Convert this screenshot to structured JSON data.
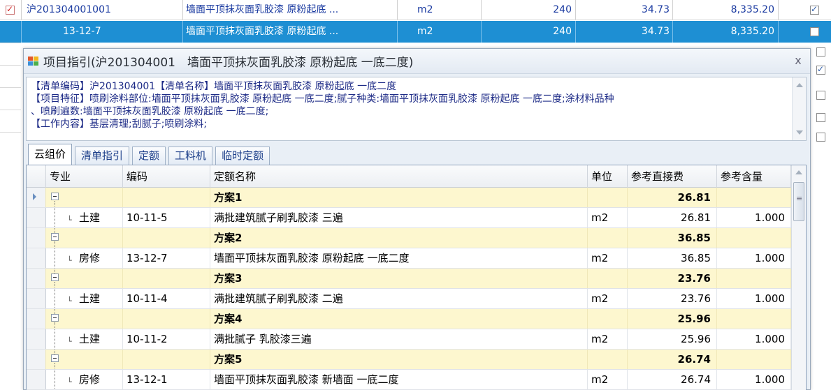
{
  "background_rows": [
    {
      "selected": false,
      "checked": true,
      "code": "沪201304001001",
      "name": "墙面平顶抹灰面乳胶漆 原粉起底 ...",
      "unit": "m2",
      "qty": "240",
      "price": "34.73",
      "total": "8,335.20",
      "right_checked": true
    },
    {
      "selected": true,
      "checked": false,
      "code": "13-12-7",
      "name": "墙面平顶抹灰面乳胶漆 原粉起底 ...",
      "unit": "m2",
      "qty": "240",
      "price": "34.73",
      "total": "8,335.20",
      "right_checked": false
    }
  ],
  "side_checkboxes": [
    false,
    true,
    false,
    false,
    false
  ],
  "dialog": {
    "title": "项目指引(沪201304001　墙面平顶抹灰面乳胶漆 原粉起底 一底二度)",
    "close_glyph": "x",
    "info_lines": [
      "【清单编码】沪201304001【清单名称】墙面平顶抹灰面乳胶漆 原粉起底 一底二度",
      "【项目特征】喷刷涂料部位:墙面平顶抹灰面乳胶漆 原粉起底 一底二度;腻子种类:墙面平顶抹灰面乳胶漆 原粉起底 一底二度;涂材料品种",
      "、喷刷遍数:墙面平顶抹灰面乳胶漆 原粉起底 一底二度;",
      "【工作内容】基层清理;刮腻子;喷刷涂料;"
    ],
    "tabs": [
      "云组价",
      "清单指引",
      "定额",
      "工料机",
      "临时定额"
    ],
    "active_tab": 0,
    "columns": [
      "专业",
      "编码",
      "定额名称",
      "单位",
      "参考直接费",
      "参考含量"
    ],
    "groups": [
      {
        "name": "方案1",
        "total": "26.81",
        "item": {
          "major": "土建",
          "code": "10-11-5",
          "name": "满批建筑腻子刷乳胶漆 三遍",
          "unit": "m2",
          "cost": "26.81",
          "qty": "1.000"
        }
      },
      {
        "name": "方案2",
        "total": "36.85",
        "item": {
          "major": "房修",
          "code": "13-12-7",
          "name": "墙面平顶抹灰面乳胶漆 原粉起底 一底二度",
          "unit": "m2",
          "cost": "36.85",
          "qty": "1.000"
        }
      },
      {
        "name": "方案3",
        "total": "23.76",
        "item": {
          "major": "土建",
          "code": "10-11-4",
          "name": "满批建筑腻子刷乳胶漆 二遍",
          "unit": "m2",
          "cost": "23.76",
          "qty": "1.000"
        }
      },
      {
        "name": "方案4",
        "total": "25.96",
        "item": {
          "major": "土建",
          "code": "10-11-2",
          "name": "满批腻子 乳胶漆三遍",
          "unit": "m2",
          "cost": "25.96",
          "qty": "1.000"
        }
      },
      {
        "name": "方案5",
        "total": "26.74",
        "item": {
          "major": "房修",
          "code": "13-12-1",
          "name": "墙面平顶抹灰面乳胶漆 新墙面 一底二度",
          "unit": "m2",
          "cost": "26.74",
          "qty": "1.000"
        }
      }
    ]
  }
}
